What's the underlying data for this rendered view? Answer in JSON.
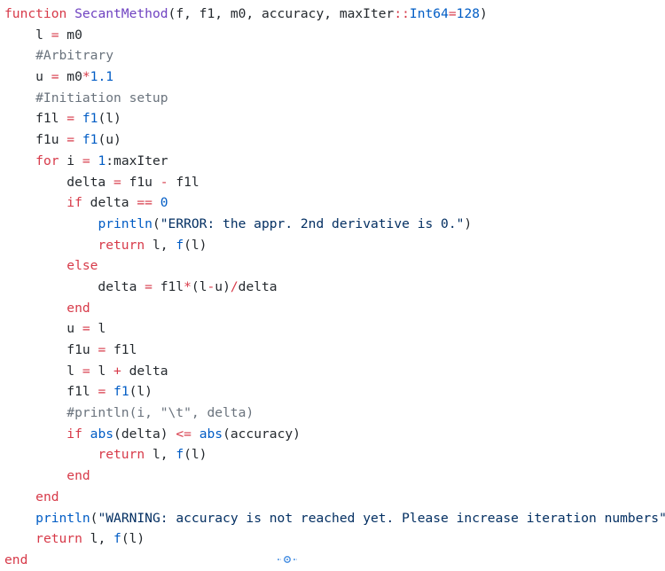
{
  "colors": {
    "background": "#ffffff",
    "keyword": "#d73a49",
    "function_name": "#6f42c1",
    "builtin_call": "#005cc5",
    "number": "#005cc5",
    "type": "#005cc5",
    "operator": "#d73a49",
    "string": "#032f62",
    "comment": "#6a737d",
    "plain": "#24292e",
    "cursor_indicator": "#4a90e2"
  },
  "editor": {
    "cursor_icon": "crosshair-target-icon",
    "lines": [
      [
        {
          "t": "function",
          "c": "keyword"
        },
        {
          "t": " ",
          "c": "plain"
        },
        {
          "t": "SecantMethod",
          "c": "fn"
        },
        {
          "t": "(f, f1, m0, accuracy, maxIter",
          "c": "plain"
        },
        {
          "t": "::",
          "c": "op"
        },
        {
          "t": "Int64",
          "c": "type"
        },
        {
          "t": "=",
          "c": "op"
        },
        {
          "t": "128",
          "c": "number"
        },
        {
          "t": ")",
          "c": "plain"
        }
      ],
      [
        {
          "t": "    l ",
          "c": "plain"
        },
        {
          "t": "=",
          "c": "op"
        },
        {
          "t": " m0",
          "c": "plain"
        }
      ],
      [
        {
          "t": "    #Arbitrary",
          "c": "comment"
        }
      ],
      [
        {
          "t": "    u ",
          "c": "plain"
        },
        {
          "t": "=",
          "c": "op"
        },
        {
          "t": " m0",
          "c": "plain"
        },
        {
          "t": "*",
          "c": "op"
        },
        {
          "t": "1.1",
          "c": "number"
        }
      ],
      [
        {
          "t": "    #Initiation setup",
          "c": "comment"
        }
      ],
      [
        {
          "t": "    f1l ",
          "c": "plain"
        },
        {
          "t": "=",
          "c": "op"
        },
        {
          "t": " ",
          "c": "plain"
        },
        {
          "t": "f1",
          "c": "call"
        },
        {
          "t": "(l)",
          "c": "plain"
        }
      ],
      [
        {
          "t": "    f1u ",
          "c": "plain"
        },
        {
          "t": "=",
          "c": "op"
        },
        {
          "t": " ",
          "c": "plain"
        },
        {
          "t": "f1",
          "c": "call"
        },
        {
          "t": "(u)",
          "c": "plain"
        }
      ],
      [
        {
          "t": "    ",
          "c": "plain"
        },
        {
          "t": "for",
          "c": "keyword"
        },
        {
          "t": " i ",
          "c": "plain"
        },
        {
          "t": "=",
          "c": "op"
        },
        {
          "t": " ",
          "c": "plain"
        },
        {
          "t": "1",
          "c": "number"
        },
        {
          "t": ":maxIter",
          "c": "plain"
        }
      ],
      [
        {
          "t": "        delta ",
          "c": "plain"
        },
        {
          "t": "=",
          "c": "op"
        },
        {
          "t": " f1u ",
          "c": "plain"
        },
        {
          "t": "-",
          "c": "op"
        },
        {
          "t": " f1l",
          "c": "plain"
        }
      ],
      [
        {
          "t": "        ",
          "c": "plain"
        },
        {
          "t": "if",
          "c": "keyword"
        },
        {
          "t": " delta ",
          "c": "plain"
        },
        {
          "t": "==",
          "c": "op"
        },
        {
          "t": " ",
          "c": "plain"
        },
        {
          "t": "0",
          "c": "number"
        }
      ],
      [
        {
          "t": "            ",
          "c": "plain"
        },
        {
          "t": "println",
          "c": "call"
        },
        {
          "t": "(",
          "c": "plain"
        },
        {
          "t": "\"ERROR: the appr. 2nd derivative is 0.\"",
          "c": "string"
        },
        {
          "t": ")",
          "c": "plain"
        }
      ],
      [
        {
          "t": "            ",
          "c": "plain"
        },
        {
          "t": "return",
          "c": "keyword"
        },
        {
          "t": " l, ",
          "c": "plain"
        },
        {
          "t": "f",
          "c": "call"
        },
        {
          "t": "(l)",
          "c": "plain"
        }
      ],
      [
        {
          "t": "        ",
          "c": "plain"
        },
        {
          "t": "else",
          "c": "keyword"
        }
      ],
      [
        {
          "t": "            delta ",
          "c": "plain"
        },
        {
          "t": "=",
          "c": "op"
        },
        {
          "t": " f1l",
          "c": "plain"
        },
        {
          "t": "*",
          "c": "op"
        },
        {
          "t": "(l",
          "c": "plain"
        },
        {
          "t": "-",
          "c": "op"
        },
        {
          "t": "u)",
          "c": "plain"
        },
        {
          "t": "/",
          "c": "op"
        },
        {
          "t": "delta",
          "c": "plain"
        }
      ],
      [
        {
          "t": "        ",
          "c": "plain"
        },
        {
          "t": "end",
          "c": "keyword"
        }
      ],
      [
        {
          "t": "        u ",
          "c": "plain"
        },
        {
          "t": "=",
          "c": "op"
        },
        {
          "t": " l",
          "c": "plain"
        }
      ],
      [
        {
          "t": "        f1u ",
          "c": "plain"
        },
        {
          "t": "=",
          "c": "op"
        },
        {
          "t": " f1l",
          "c": "plain"
        }
      ],
      [
        {
          "t": "        l ",
          "c": "plain"
        },
        {
          "t": "=",
          "c": "op"
        },
        {
          "t": " l ",
          "c": "plain"
        },
        {
          "t": "+",
          "c": "op"
        },
        {
          "t": " delta",
          "c": "plain"
        }
      ],
      [
        {
          "t": "        f1l ",
          "c": "plain"
        },
        {
          "t": "=",
          "c": "op"
        },
        {
          "t": " ",
          "c": "plain"
        },
        {
          "t": "f1",
          "c": "call"
        },
        {
          "t": "(l)",
          "c": "plain"
        }
      ],
      [
        {
          "t": "        #println(i, \"\\t\", delta)",
          "c": "comment"
        }
      ],
      [
        {
          "t": "        ",
          "c": "plain"
        },
        {
          "t": "if",
          "c": "keyword"
        },
        {
          "t": " ",
          "c": "plain"
        },
        {
          "t": "abs",
          "c": "call"
        },
        {
          "t": "(delta) ",
          "c": "plain"
        },
        {
          "t": "<=",
          "c": "op"
        },
        {
          "t": " ",
          "c": "plain"
        },
        {
          "t": "abs",
          "c": "call"
        },
        {
          "t": "(accuracy)",
          "c": "plain"
        }
      ],
      [
        {
          "t": "            ",
          "c": "plain"
        },
        {
          "t": "return",
          "c": "keyword"
        },
        {
          "t": " l, ",
          "c": "plain"
        },
        {
          "t": "f",
          "c": "call"
        },
        {
          "t": "(l)",
          "c": "plain"
        }
      ],
      [
        {
          "t": "        ",
          "c": "plain"
        },
        {
          "t": "end",
          "c": "keyword"
        }
      ],
      [
        {
          "t": "    ",
          "c": "plain"
        },
        {
          "t": "end",
          "c": "keyword"
        }
      ],
      [
        {
          "t": "    ",
          "c": "plain"
        },
        {
          "t": "println",
          "c": "call"
        },
        {
          "t": "(",
          "c": "plain"
        },
        {
          "t": "\"WARNING: accuracy is not reached yet. Please increase iteration numbers\"",
          "c": "string"
        },
        {
          "t": ")",
          "c": "plain"
        }
      ],
      [
        {
          "t": "    ",
          "c": "plain"
        },
        {
          "t": "return",
          "c": "keyword"
        },
        {
          "t": " l, ",
          "c": "plain"
        },
        {
          "t": "f",
          "c": "call"
        },
        {
          "t": "(l)",
          "c": "plain"
        }
      ],
      [
        {
          "t": "end",
          "c": "keyword"
        }
      ]
    ]
  }
}
